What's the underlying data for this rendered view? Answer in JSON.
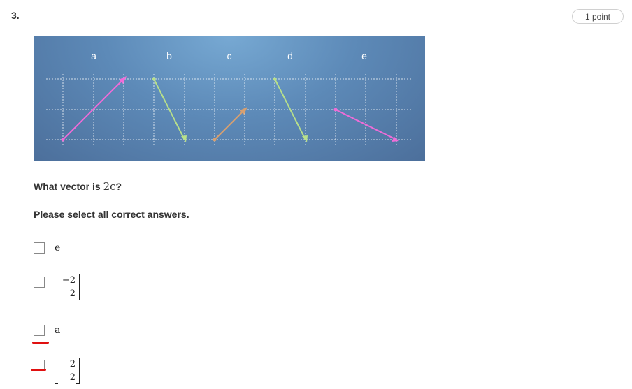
{
  "question": {
    "number": "3.",
    "points": "1 point",
    "prompt_prefix": "What vector is",
    "prompt_math": "2c",
    "prompt_suffix": "?",
    "instruction": "Please select all correct answers."
  },
  "figure": {
    "vector_labels": [
      "a",
      "b",
      "c",
      "d",
      "e"
    ],
    "vector_colors": {
      "a": "#f06cd8",
      "b": "#b8e08a",
      "c": "#d8a070",
      "d": "#b8e08a",
      "e": "#f06cd8"
    }
  },
  "options": [
    {
      "type": "text",
      "label": "e"
    },
    {
      "type": "matrix",
      "top": "−2",
      "bottom": "2"
    },
    {
      "type": "text",
      "label": "a"
    },
    {
      "type": "matrix",
      "top": "2",
      "bottom": "2"
    }
  ],
  "colors": {
    "annotation_mark": "#e01010",
    "figure_bg": "#5d8ab8"
  }
}
